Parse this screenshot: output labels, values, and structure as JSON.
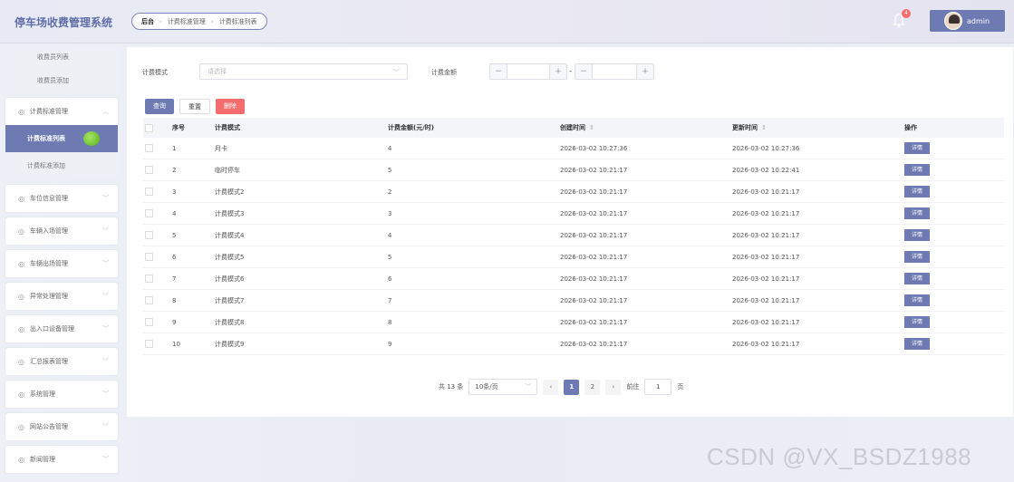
{
  "header": {
    "app_title": "停车场收费管理系统",
    "breadcrumb": [
      "后台",
      "计费标准管理",
      "计费标准列表"
    ],
    "notification_count": "4",
    "user_name": "admin"
  },
  "sidebar": {
    "top_subitems": [
      "收费员列表",
      "收费员添加"
    ],
    "active_group": "计费标准管理",
    "active_item": "计费标准列表",
    "active_group_sub2": "计费标准添加",
    "groups": [
      "车位信息管理",
      "车辆入场管理",
      "车辆出场管理",
      "异常处理管理",
      "出入口设备管理",
      "汇总报表管理",
      "系统管理",
      "网站公告管理",
      "新闻管理"
    ]
  },
  "filters": {
    "mode_label": "计费模式",
    "mode_placeholder": "请选择",
    "amount_label": "计费金额",
    "minus": "−",
    "plus": "+",
    "range_sep": "-"
  },
  "buttons": {
    "query": "查询",
    "reset": "重置",
    "delete": "删除"
  },
  "table": {
    "headers": {
      "no": "序号",
      "mode": "计费模式",
      "amount": "计费金额(元/时)",
      "created": "创建时间",
      "updated": "更新时间",
      "action": "操作"
    },
    "detail_label": "详情",
    "rows": [
      {
        "no": "1",
        "mode": "月卡",
        "amount": "4",
        "created": "2026-03-02 10:27:36",
        "updated": "2026-03-02 10:27:36"
      },
      {
        "no": "2",
        "mode": "临时停车",
        "amount": "5",
        "created": "2026-03-02 10:21:17",
        "updated": "2026-03-02 10:22:41"
      },
      {
        "no": "3",
        "mode": "计费模式2",
        "amount": "2",
        "created": "2026-03-02 10:21:17",
        "updated": "2026-03-02 10:21:17"
      },
      {
        "no": "4",
        "mode": "计费模式3",
        "amount": "3",
        "created": "2026-03-02 10:21:17",
        "updated": "2026-03-02 10:21:17"
      },
      {
        "no": "5",
        "mode": "计费模式4",
        "amount": "4",
        "created": "2026-03-02 10:21:17",
        "updated": "2026-03-02 10:21:17"
      },
      {
        "no": "6",
        "mode": "计费模式5",
        "amount": "5",
        "created": "2026-03-02 10:21:17",
        "updated": "2026-03-02 10:21:17"
      },
      {
        "no": "7",
        "mode": "计费模式6",
        "amount": "6",
        "created": "2026-03-02 10:21:17",
        "updated": "2026-03-02 10:21:17"
      },
      {
        "no": "8",
        "mode": "计费模式7",
        "amount": "7",
        "created": "2026-03-02 10:21:17",
        "updated": "2026-03-02 10:21:17"
      },
      {
        "no": "9",
        "mode": "计费模式8",
        "amount": "8",
        "created": "2026-03-02 10:21:17",
        "updated": "2026-03-02 10:21:17"
      },
      {
        "no": "10",
        "mode": "计费模式9",
        "amount": "9",
        "created": "2026-03-02 10:21:17",
        "updated": "2026-03-02 10:21:17"
      }
    ]
  },
  "pagination": {
    "total": "共 13 条",
    "page_size": "10条/页",
    "prev": "‹",
    "next": "›",
    "pages": [
      "1",
      "2"
    ],
    "goto_label": "前往",
    "goto_value": "1",
    "page_unit": "页"
  },
  "watermark": "CSDN @VX_BSDZ1988",
  "colors": {
    "primary": "#6e7bb3",
    "danger": "#f56c6c"
  }
}
